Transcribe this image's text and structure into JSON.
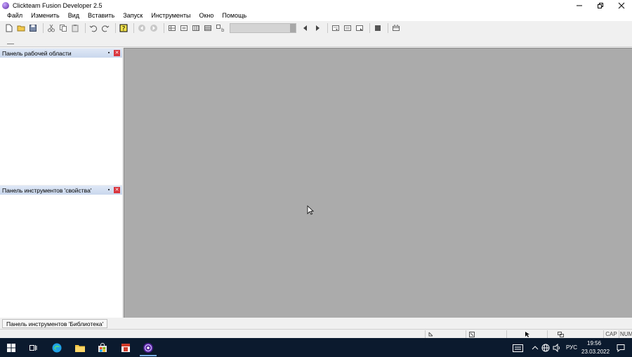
{
  "window": {
    "title": "Clickteam Fusion Developer 2.5"
  },
  "menu": [
    "Файл",
    "Изменить",
    "Вид",
    "Вставить",
    "Запуск",
    "Инструменты",
    "Окно",
    "Помощь"
  ],
  "panels": {
    "workspace": {
      "title": "Панель рабочей области"
    },
    "properties": {
      "title": "Панель инструментов 'свойства'"
    }
  },
  "library_tab": {
    "label": "Панель инструментов 'Библиотека'"
  },
  "statusbar": {
    "cap": "CAP",
    "num": "NUM"
  },
  "taskbar": {
    "language": "РУС",
    "time": "19:56",
    "date": "23.03.2022"
  },
  "colors": {
    "workarea": "#ababab",
    "taskbar": "#0b1a2e",
    "close": "#d9363e"
  }
}
